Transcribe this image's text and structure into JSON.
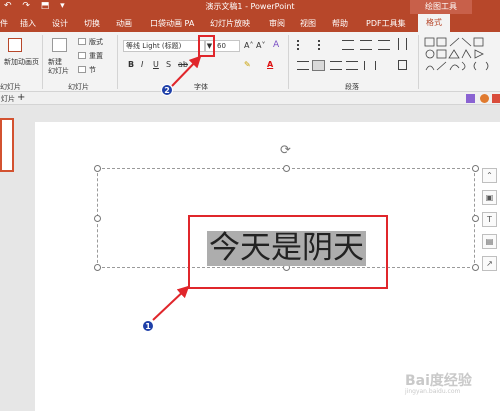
{
  "titlebar": {
    "quick_access": "↶ ↷ ⬒ ▾",
    "title": "演示文稿1  -  PowerPoint",
    "context_tab": "绘图工具"
  },
  "tabs": [
    "件",
    "插入",
    "设计",
    "切换",
    "动画",
    "口袋动画 PA",
    "幻灯片放映",
    "审阅",
    "视图",
    "帮助",
    "PDF工具集",
    "格式"
  ],
  "ribbon": {
    "new_slide": "新加动画页",
    "new_slide_sub": "幻灯片",
    "new_slide_btn": "新建\n幻灯片",
    "layout": "版式",
    "reset": "重置",
    "section": "节",
    "group_slides": "幻灯片",
    "font_name": "等线 Light (标题)",
    "font_dropdown": "▼",
    "font_size": "60",
    "grow": "A˄",
    "shrink": "A˅",
    "clear": "A",
    "bold": "B",
    "italic": "I",
    "underline": "U",
    "strike": "S",
    "shadow": "ab",
    "highlight": "✎",
    "fontcolor": "A",
    "group_font": "字体",
    "group_paragraph": "段落"
  },
  "strip": {
    "left": "灯片",
    "plus": "+"
  },
  "slide": {
    "text": "今天是阴天"
  },
  "callouts": {
    "one": "1",
    "two": "2"
  },
  "side_buttons": [
    "⌃",
    "▣",
    "T",
    "▤",
    "↗"
  ],
  "watermark": {
    "main": "Bai度经验",
    "sub": "jingyan.baidu.com"
  }
}
